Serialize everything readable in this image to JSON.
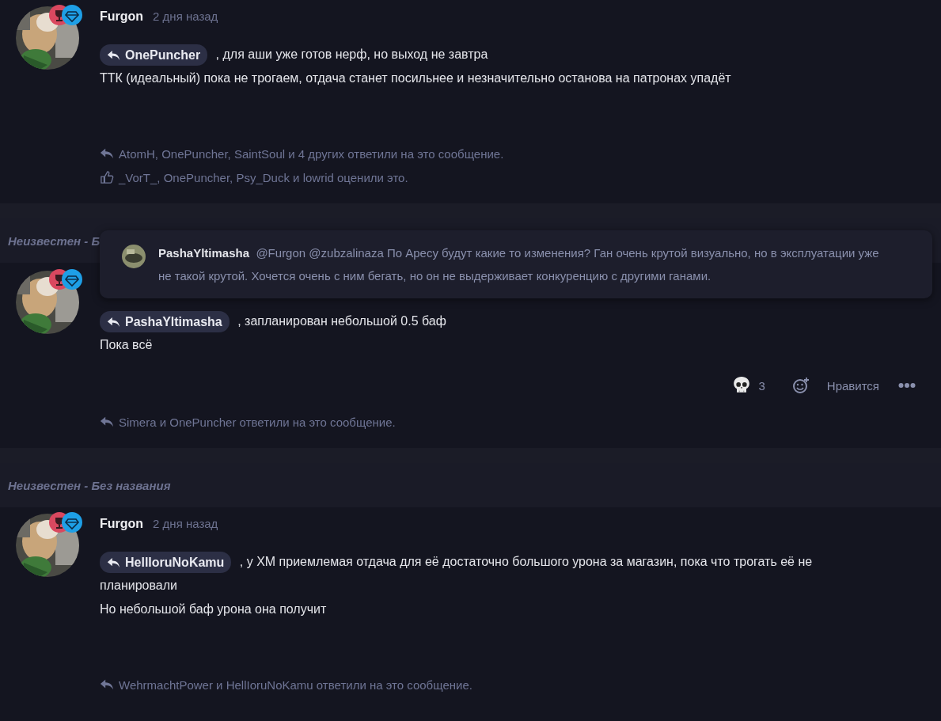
{
  "posts": [
    {
      "author": "Furgon",
      "time": "2 дня назад",
      "reply_to": "OnePuncher",
      "lines": [
        ", для аши уже готов нерф, но выход не завтра",
        "ТТК (идеальный) пока не трогаем, отдача станет посильнее и незначительно останова на патронах упадёт"
      ],
      "replies": "AtomH, OnePuncher, SaintSoul и 4 других ответили на это сообщение.",
      "likes": "_VorT_, OnePuncher, Psy_Duck и lowrid оценили это."
    },
    {
      "thread_title": "Неизвестен - Б",
      "quote": {
        "author": "PashaYltimasha",
        "text": "@Furgon @zubzalinaza По Аресу будут какие то изменения? Ган очень крутой визуально, но в эксплуатации уже не такой крутой. Хочется очень с ним бегать, но он не выдерживает конкуренцию с другими ганами."
      },
      "reply_to": "PashaYltimasha",
      "lines": [
        ", запланирован небольшой 0.5 баф",
        "Пока всё"
      ],
      "reactions": {
        "count": "3",
        "like_label": "Нравится"
      },
      "replies": "Simera и OnePuncher ответили на это сообщение."
    },
    {
      "thread_title": "Неизвестен - Без названия",
      "author": "Furgon",
      "time": "2 дня назад",
      "reply_to": "HellIoruNoKamu",
      "lines": [
        ", у ХМ приемлемая отдача для её достаточно большого урона за магазин, пока что трогать её не",
        "планировали",
        "Но небольшой баф урона она получит"
      ],
      "replies": "WehrmachtPower и HellIoruNoKamu ответили на это сообщение."
    }
  ]
}
